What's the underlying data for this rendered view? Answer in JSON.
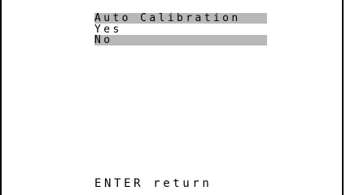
{
  "menu": {
    "title": "Auto Calibration",
    "options": [
      {
        "label": "Yes",
        "selected": false
      },
      {
        "label": "No",
        "selected": true
      }
    ]
  },
  "footer": {
    "hint": "ENTER return"
  },
  "colors": {
    "highlight": "#b8b8b8",
    "text": "#000000",
    "background": "#ffffff"
  }
}
